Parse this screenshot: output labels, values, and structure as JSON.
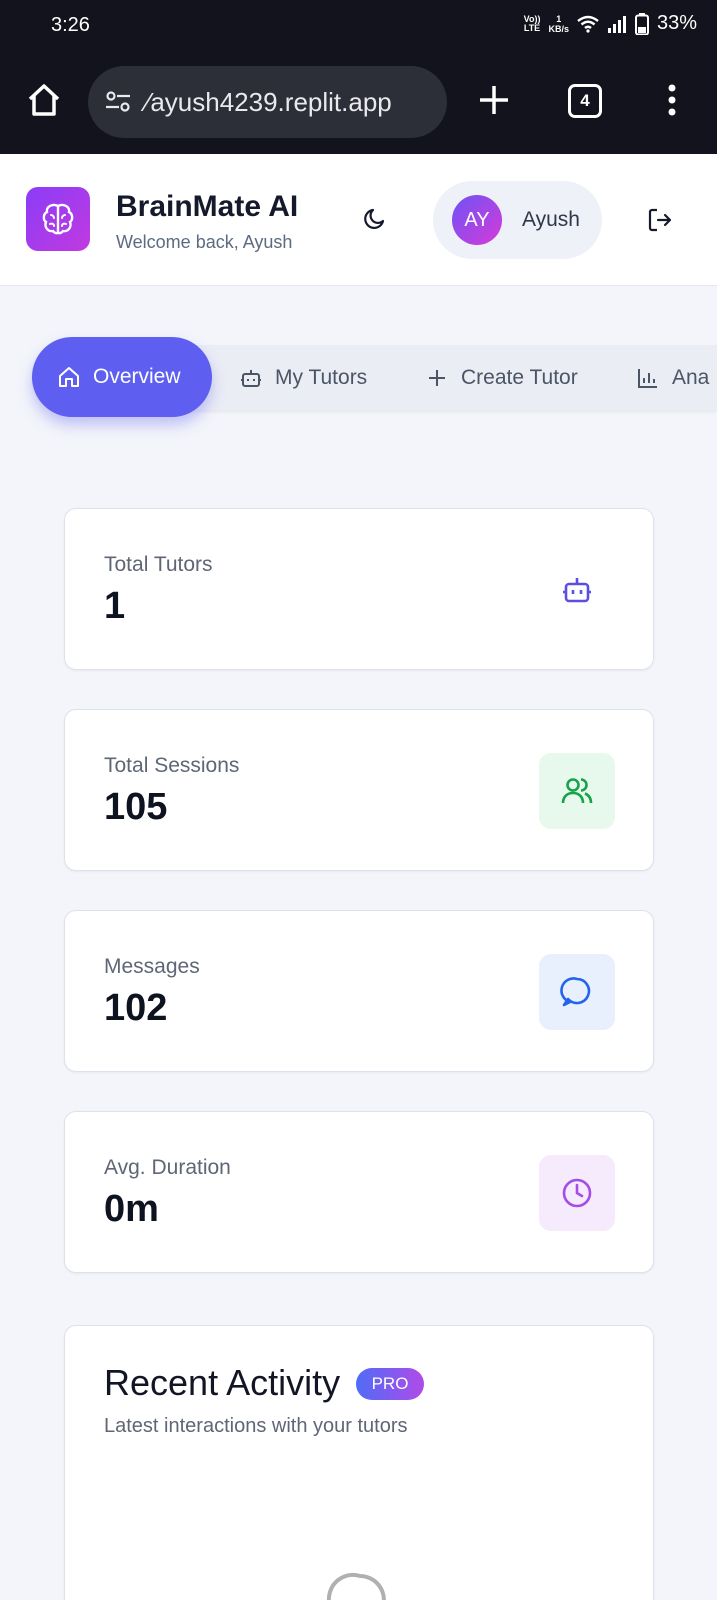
{
  "status": {
    "time": "3:26",
    "network_top": "Vo))",
    "network_bottom": "LTE",
    "speed_value": "1",
    "speed_unit": "KB/s",
    "battery": "33%"
  },
  "browser": {
    "url": "⁄ayush4239.replit.app",
    "tab_count": "4"
  },
  "header": {
    "title": "BrainMate AI",
    "subtitle": "Welcome back, Ayush",
    "avatar_initials": "AY",
    "user_name": "Ayush"
  },
  "tabs": [
    {
      "label": "Overview",
      "icon": "home-icon",
      "active": true
    },
    {
      "label": "My Tutors",
      "icon": "robot-icon"
    },
    {
      "label": "Create Tutor",
      "icon": "plus-icon"
    },
    {
      "label": "Ana",
      "icon": "bar-chart-icon"
    }
  ],
  "stats": [
    {
      "label": "Total Tutors",
      "value": "1",
      "icon": "robot-icon",
      "icon_color": "#5b4fe0",
      "icon_bg": "transparent"
    },
    {
      "label": "Total Sessions",
      "value": "105",
      "icon": "users-icon",
      "icon_color": "#16a34a",
      "icon_bg": "#e7f8ec"
    },
    {
      "label": "Messages",
      "value": "102",
      "icon": "message-icon",
      "icon_color": "#2563eb",
      "icon_bg": "#e8f0fd"
    },
    {
      "label": "Avg. Duration",
      "value": "0m",
      "icon": "clock-icon",
      "icon_color": "#a44de8",
      "icon_bg": "#f6eafd"
    }
  ],
  "activity": {
    "title": "Recent Activity",
    "badge": "PRO",
    "subtitle": "Latest interactions with your tutors"
  }
}
